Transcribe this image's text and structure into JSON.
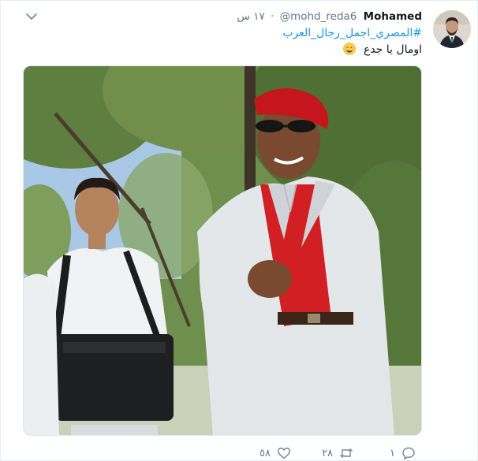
{
  "tweet": {
    "author": {
      "name": "Mohamed",
      "handle": "@mohd_reda6"
    },
    "time": "١٧ س",
    "separator": "·",
    "hashtag": "#المصري_اجمل_رجال_العرب",
    "text": "اومال يا جدع",
    "emoji": "grinning-face-emoji",
    "stats": {
      "replies": "١",
      "retweets": "٢٨",
      "likes": "٥٨"
    }
  },
  "colors": {
    "link": "#1b95e0",
    "secondary_text": "#657786",
    "border": "#e6ecf0"
  },
  "icons": [
    "chevron-down-icon",
    "reply-icon",
    "retweet-icon",
    "like-icon"
  ]
}
